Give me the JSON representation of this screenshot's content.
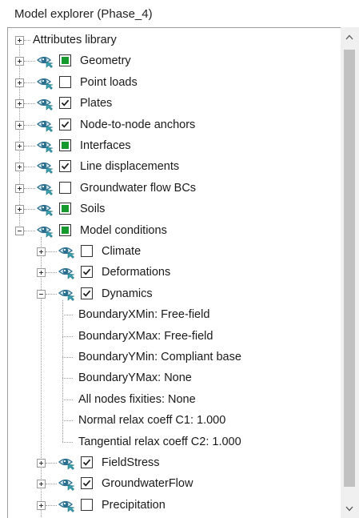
{
  "window": {
    "title": "Model explorer (Phase_4)"
  },
  "tree": {
    "items": [
      {
        "label": "Attributes library",
        "level": 0,
        "expander": "plus",
        "eye": false,
        "check": "none"
      },
      {
        "label": "Geometry",
        "level": 0,
        "expander": "plus",
        "eye": true,
        "check": "filled"
      },
      {
        "label": "Point loads",
        "level": 0,
        "expander": "plus",
        "eye": true,
        "check": "empty"
      },
      {
        "label": "Plates",
        "level": 0,
        "expander": "plus",
        "eye": true,
        "check": "checked"
      },
      {
        "label": "Node-to-node anchors",
        "level": 0,
        "expander": "plus",
        "eye": true,
        "check": "checked"
      },
      {
        "label": "Interfaces",
        "level": 0,
        "expander": "plus",
        "eye": true,
        "check": "filled"
      },
      {
        "label": "Line displacements",
        "level": 0,
        "expander": "plus",
        "eye": true,
        "check": "checked"
      },
      {
        "label": "Groundwater flow BCs",
        "level": 0,
        "expander": "plus",
        "eye": true,
        "check": "empty"
      },
      {
        "label": "Soils",
        "level": 0,
        "expander": "plus",
        "eye": true,
        "check": "filled"
      },
      {
        "label": "Model conditions",
        "level": 0,
        "expander": "minus",
        "eye": true,
        "check": "filled"
      },
      {
        "label": "Climate",
        "level": 1,
        "expander": "plus",
        "eye": true,
        "check": "empty"
      },
      {
        "label": "Deformations",
        "level": 1,
        "expander": "plus",
        "eye": true,
        "check": "checked"
      },
      {
        "label": "Dynamics",
        "level": 1,
        "expander": "minus",
        "eye": true,
        "check": "checked"
      },
      {
        "label": "BoundaryXMin: Free-field",
        "level": 2,
        "expander": "none",
        "eye": false,
        "check": "none"
      },
      {
        "label": "BoundaryXMax: Free-field",
        "level": 2,
        "expander": "none",
        "eye": false,
        "check": "none"
      },
      {
        "label": "BoundaryYMin: Compliant base",
        "level": 2,
        "expander": "none",
        "eye": false,
        "check": "none"
      },
      {
        "label": "BoundaryYMax: None",
        "level": 2,
        "expander": "none",
        "eye": false,
        "check": "none"
      },
      {
        "label": "All nodes fixities: None",
        "level": 2,
        "expander": "none",
        "eye": false,
        "check": "none"
      },
      {
        "label": "Normal relax coeff C1: 1.000",
        "level": 2,
        "expander": "none",
        "eye": false,
        "check": "none"
      },
      {
        "label": "Tangential relax coeff C2: 1.000",
        "level": 2,
        "expander": "none",
        "eye": false,
        "check": "none"
      },
      {
        "label": "FieldStress",
        "level": 1,
        "expander": "plus",
        "eye": true,
        "check": "checked"
      },
      {
        "label": "GroundwaterFlow",
        "level": 1,
        "expander": "plus",
        "eye": true,
        "check": "checked"
      },
      {
        "label": "Precipitation",
        "level": 1,
        "expander": "plus",
        "eye": true,
        "check": "empty"
      }
    ]
  },
  "colors": {
    "filled_square": "#159a2e",
    "eye_dark": "#2b6f8f",
    "eye_teal": "#3aa3b3",
    "scrollbar_track": "#f0f0f0",
    "scrollbar_thumb": "#c1c1c1"
  },
  "icons": {
    "visibility": "eye-icon",
    "expand": "plus-box-icon",
    "collapse": "minus-box-icon",
    "scroll_up": "chevron-up-icon",
    "scroll_down": "chevron-down-icon"
  }
}
